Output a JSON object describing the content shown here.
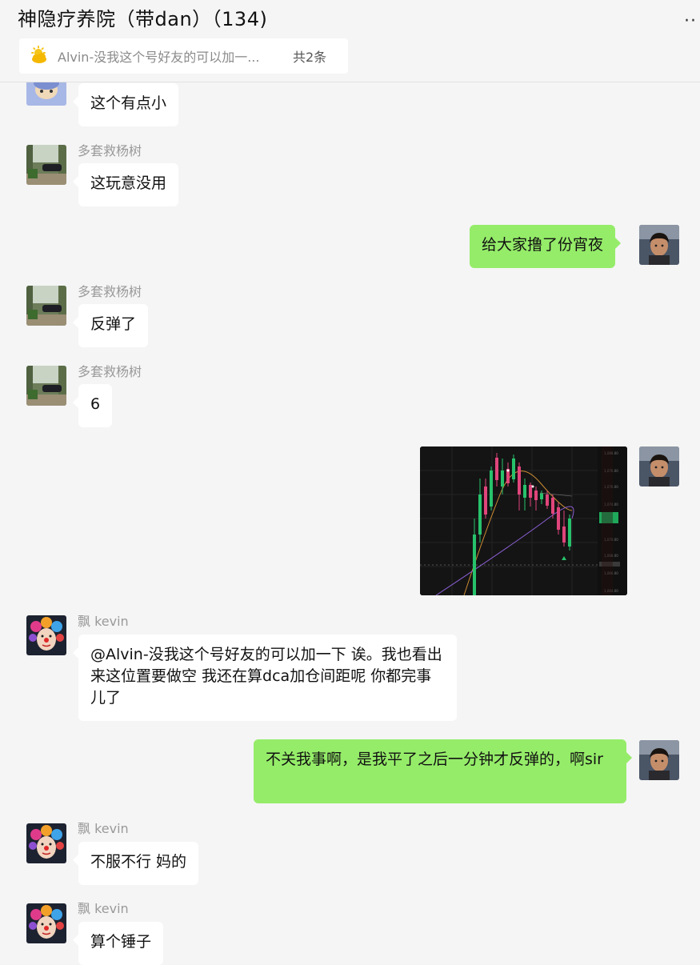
{
  "header": {
    "title": "神隐疗养院（带dan）（134)",
    "more_icon": "more-dots-icon",
    "notice": {
      "icon": "sun-icon",
      "text": "Alvin-没我这个号好友的可以加一...",
      "count": "共2条"
    }
  },
  "messages": [
    {
      "side": "left",
      "sender": "",
      "avatar": "avatar-cartoon",
      "text": "这个有点小"
    },
    {
      "side": "left",
      "sender": "多套救杨树",
      "avatar": "avatar-car-photo",
      "text": "这玩意没用"
    },
    {
      "side": "right",
      "avatar": "avatar-self",
      "text": "给大家撸了份宵夜"
    },
    {
      "side": "left",
      "sender": "多套救杨树",
      "avatar": "avatar-car-photo",
      "text": "反弹了"
    },
    {
      "side": "left",
      "sender": "多套救杨树",
      "avatar": "avatar-car-photo",
      "text": "6"
    },
    {
      "side": "right",
      "avatar": "avatar-self",
      "type": "image",
      "image": "candlestick-chart-screenshot"
    },
    {
      "side": "left",
      "sender": "飘 kevin",
      "avatar": "avatar-clown",
      "text": "@Alvin-没我这个号好友的可以加一下 诶。我也看出来这位置要做空 我还在算dca加仓间距呢 你都完事儿了"
    },
    {
      "side": "right",
      "avatar": "avatar-self",
      "text": "不关我事啊，是我平了之后一分钟才反弹的，啊sir"
    },
    {
      "side": "left",
      "sender": "飘 kevin",
      "avatar": "avatar-clown",
      "text": "不服不行 妈的"
    },
    {
      "side": "left",
      "sender": "飘 kevin",
      "avatar": "avatar-clown",
      "text": "算个锤子"
    }
  ],
  "colors": {
    "background": "#f5f5f5",
    "bubble_self": "#95ec69",
    "bubble_other": "#ffffff",
    "sender_name": "#9a9a9a",
    "candle_up": "#27c26c",
    "candle_down": "#e0457b"
  }
}
